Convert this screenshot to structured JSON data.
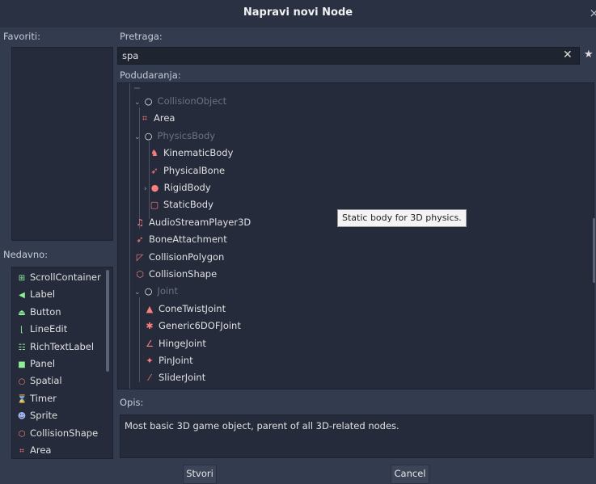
{
  "window": {
    "title": "Napravi novi Node",
    "close": "×"
  },
  "favorites": {
    "label": "Favoriti:"
  },
  "search": {
    "label": "Pretraga:",
    "value": "spa",
    "clear": "✕",
    "star": "★"
  },
  "matches": {
    "label": "Podudaranja:"
  },
  "tree": [
    {
      "label": "CollisionObject",
      "icon": "○",
      "icon_name": "spatial-icon",
      "color": "#ffffff",
      "disabled": true,
      "arrow": "⌄"
    },
    {
      "label": "Area",
      "icon": "⌗",
      "icon_name": "area-icon",
      "color": "#fc7f7f",
      "disabled": false,
      "arrow": ""
    },
    {
      "label": "PhysicsBody",
      "icon": "○",
      "icon_name": "spatial-icon",
      "color": "#ffffff",
      "disabled": true,
      "arrow": "⌄"
    },
    {
      "label": "KinematicBody",
      "icon": "♞",
      "icon_name": "kinematic-body-icon",
      "color": "#fc7f7f",
      "disabled": false,
      "arrow": ""
    },
    {
      "label": "PhysicalBone",
      "icon": "➶",
      "icon_name": "physical-bone-icon",
      "color": "#fc7f7f",
      "disabled": false,
      "arrow": ""
    },
    {
      "label": "RigidBody",
      "icon": "●",
      "icon_name": "rigid-body-icon",
      "color": "#fc7f7f",
      "disabled": false,
      "arrow": "›"
    },
    {
      "label": "StaticBody",
      "icon": "▢",
      "icon_name": "static-body-icon",
      "color": "#fc7f7f",
      "disabled": false,
      "arrow": ""
    },
    {
      "label": "AudioStreamPlayer3D",
      "icon": "♫",
      "icon_name": "audio-stream-player-3d-icon",
      "color": "#fc7f7f",
      "disabled": false,
      "arrow": ""
    },
    {
      "label": "BoneAttachment",
      "icon": "➶",
      "icon_name": "bone-attachment-icon",
      "color": "#fc7f7f",
      "disabled": false,
      "arrow": ""
    },
    {
      "label": "CollisionPolygon",
      "icon": "◸",
      "icon_name": "collision-polygon-icon",
      "color": "#fc7f7f",
      "disabled": false,
      "arrow": ""
    },
    {
      "label": "CollisionShape",
      "icon": "⬡",
      "icon_name": "collision-shape-icon",
      "color": "#fc7f7f",
      "disabled": false,
      "arrow": ""
    },
    {
      "label": "Joint",
      "icon": "○",
      "icon_name": "spatial-icon",
      "color": "#ffffff",
      "disabled": true,
      "arrow": "⌄"
    },
    {
      "label": "ConeTwistJoint",
      "icon": "▲",
      "icon_name": "cone-twist-joint-icon",
      "color": "#fc7f7f",
      "disabled": false,
      "arrow": ""
    },
    {
      "label": "Generic6DOFJoint",
      "icon": "✱",
      "icon_name": "generic-6dof-joint-icon",
      "color": "#fc7f7f",
      "disabled": false,
      "arrow": ""
    },
    {
      "label": "HingeJoint",
      "icon": "∠",
      "icon_name": "hinge-joint-icon",
      "color": "#fc7f7f",
      "disabled": false,
      "arrow": ""
    },
    {
      "label": "PinJoint",
      "icon": "✦",
      "icon_name": "pin-joint-icon",
      "color": "#fc7f7f",
      "disabled": false,
      "arrow": ""
    },
    {
      "label": "SliderJoint",
      "icon": "⁄",
      "icon_name": "slider-joint-icon",
      "color": "#fc7f7f",
      "disabled": false,
      "arrow": ""
    }
  ],
  "tooltip": "Static body for 3D physics.",
  "recent": {
    "label": "Nedavno:",
    "items": [
      {
        "label": "ScrollContainer",
        "icon": "⊞",
        "icon_name": "scroll-container-icon",
        "color": "#8eef97"
      },
      {
        "label": "Label",
        "icon": "◀",
        "icon_name": "label-icon",
        "color": "#8eef97"
      },
      {
        "label": "Button",
        "icon": "⏏",
        "icon_name": "button-icon",
        "color": "#8eef97"
      },
      {
        "label": "LineEdit",
        "icon": "⌊",
        "icon_name": "line-edit-icon",
        "color": "#8eef97"
      },
      {
        "label": "RichTextLabel",
        "icon": "☷",
        "icon_name": "rich-text-label-icon",
        "color": "#8eef97"
      },
      {
        "label": "Panel",
        "icon": "■",
        "icon_name": "panel-icon",
        "color": "#8eef97"
      },
      {
        "label": "Spatial",
        "icon": "○",
        "icon_name": "spatial-icon",
        "color": "#fc7f7f"
      },
      {
        "label": "Timer",
        "icon": "⌛",
        "icon_name": "timer-icon",
        "color": "#e0e0e0"
      },
      {
        "label": "Sprite",
        "icon": "☻",
        "icon_name": "sprite-icon",
        "color": "#a5b7f3"
      },
      {
        "label": "CollisionShape",
        "icon": "⬡",
        "icon_name": "collision-shape-icon",
        "color": "#fc7f7f"
      },
      {
        "label": "Area",
        "icon": "⌗",
        "icon_name": "area-icon",
        "color": "#fc7f7f"
      }
    ]
  },
  "description": {
    "label": "Opis:",
    "text": "Most basic 3D game object, parent of all 3D-related nodes."
  },
  "buttons": {
    "create": "Stvori",
    "cancel": "Cancel"
  }
}
